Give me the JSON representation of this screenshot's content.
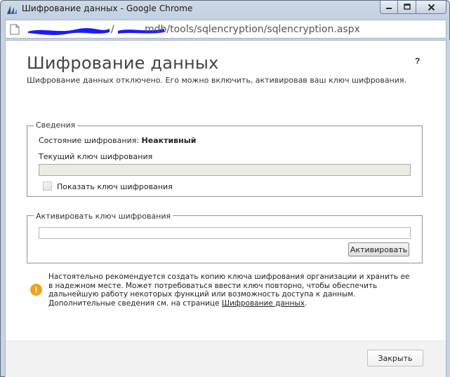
{
  "window": {
    "title": "Шифрование данных - Google Chrome",
    "url_path": "mdb/tools/sqlencryption/sqlencryption.aspx",
    "url_prefix": "/"
  },
  "page": {
    "title": "Шифрование данных",
    "help": "?",
    "subtitle": "Шифрование данных отключено. Его можно включить, активировав ваш ключ шифрования."
  },
  "info_section": {
    "legend": "Сведения",
    "status_label": "Состояние шифрования: ",
    "status_value": "Неактивный",
    "current_key_label": "Текущий ключ шифрования",
    "current_key_value": "",
    "show_key_label": "Показать ключ шифрования"
  },
  "activate_section": {
    "legend": "Активировать ключ шифрования",
    "key_input_value": "",
    "activate_button": "Активировать"
  },
  "notice": {
    "text": "Настоятельно рекомендуется создать копию ключа шифрования организации и хранить ее в надежном месте. Может потребоваться ввести ключ повторно, чтобы обеспечить дальнейшую работу некоторых функций или возможность доступа к данным. Дополнительные сведения см. на странице ",
    "link": "Шифрование данных",
    "end": "."
  },
  "footer": {
    "close_button": "Закрыть"
  },
  "colors": {
    "warning": "#f1a21c",
    "redaction": "#1a1aff"
  }
}
